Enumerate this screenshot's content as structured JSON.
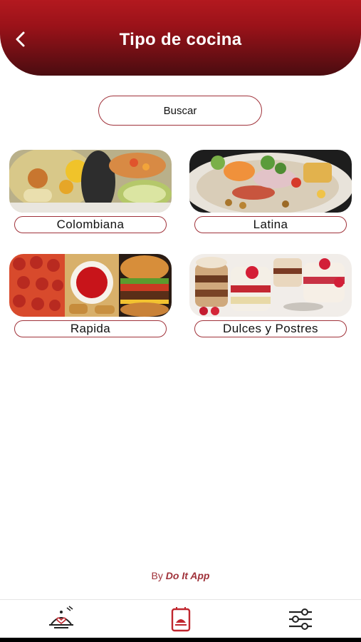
{
  "header": {
    "title": "Tipo de cocina"
  },
  "search": {
    "label": "Buscar"
  },
  "categories": [
    {
      "label": "Colombiana",
      "photo": "colombian-food-photo"
    },
    {
      "label": "Latina",
      "photo": "ceviche-photo"
    },
    {
      "label": "Rapida",
      "photo": "fast-food-photo"
    },
    {
      "label": "Dulces y Postres",
      "photo": "desserts-photo"
    }
  ],
  "footer": {
    "by": "By",
    "brand": "Do It App"
  },
  "nav": {
    "items": [
      {
        "icon": "dish-heart-icon"
      },
      {
        "icon": "recipe-book-icon"
      },
      {
        "icon": "sliders-icon"
      }
    ]
  },
  "colors": {
    "header_top": "#b3191f",
    "header_bottom": "#4a0c10",
    "accent": "#a0323a"
  }
}
